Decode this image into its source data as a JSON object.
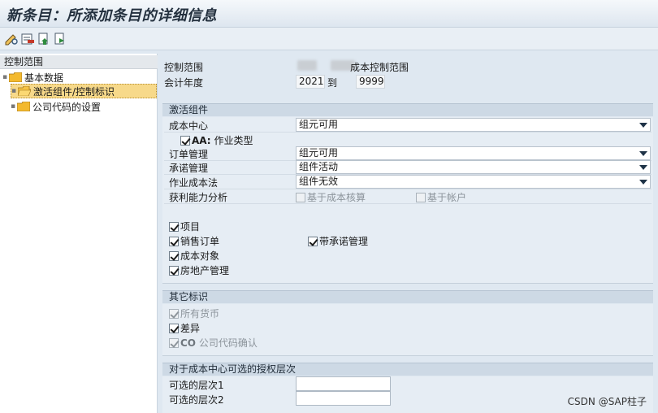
{
  "window": {
    "title": "新条目：所添加条目的详细信息"
  },
  "toolbar": {
    "icons": [
      "edit-display-icon",
      "delete-row-icon",
      "copy-entry-icon",
      "navigate-icon"
    ]
  },
  "nav": {
    "header": "控制范围",
    "items": [
      {
        "label": "基本数据",
        "icon": "folder-icon"
      },
      {
        "label": "激活组件/控制标识",
        "icon": "folder-open-icon",
        "selected": true
      },
      {
        "label": "公司代码的设置",
        "icon": "folder-icon"
      }
    ]
  },
  "header_fields": {
    "controlling_area_label": "控制范围",
    "controlling_area_name_suffix": "成本控制范围",
    "fiscal_year_label": "会计年度",
    "year_from": "2021",
    "to_label": "到",
    "year_to": "9999"
  },
  "components": {
    "title": "激活组件",
    "cost_center_label": "成本中心",
    "cost_center_value": "组元可用",
    "aa_label_bold": "AA:",
    "aa_label": "作业类型",
    "order_mgmt_label": "订单管理",
    "order_mgmt_value": "组元可用",
    "commitment_label": "承诺管理",
    "commitment_value": "组件活动",
    "activity_costing_label": "作业成本法",
    "activity_costing_value": "组件无效",
    "profitability_label": "获利能力分析",
    "profit_costing_based": "基于成本核算",
    "profit_account_based": "基于帐户",
    "projects": "项目",
    "sales_orders": "销售订单",
    "with_commitment": "带承诺管理",
    "cost_objects": "成本对象",
    "real_estate": "房地产管理"
  },
  "other_flags": {
    "title": "其它标识",
    "all_currencies": "所有货币",
    "variances": "差异",
    "co_code_validation_bold": "CO",
    "co_code_validation": "公司代码确认"
  },
  "auth_hierarchy": {
    "title": "对于成本中心可选的授权层次",
    "level1_label": "可选的层次1",
    "level1_value": "",
    "level2_label": "可选的层次2",
    "level2_value": ""
  },
  "watermark": "CSDN @SAP柱子",
  "colors": {
    "selected": "#f7d98a",
    "group_header": "#cdd9e5",
    "background": "#dfe8f1"
  }
}
